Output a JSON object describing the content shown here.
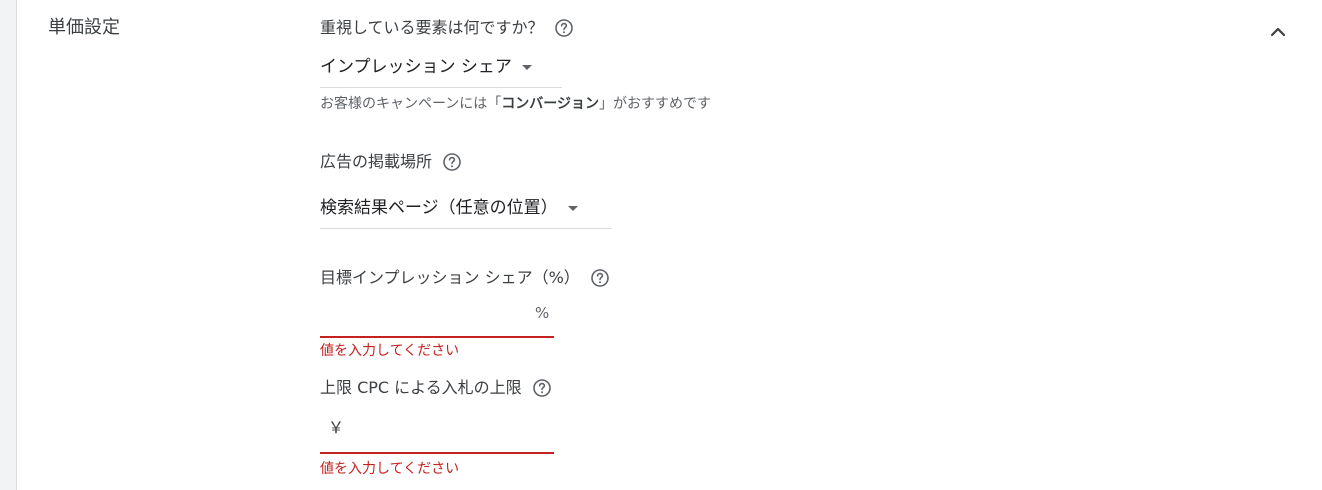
{
  "section": {
    "title": "単価設定",
    "collapse_icon": "chevron-up-icon"
  },
  "focus": {
    "label": "重視している要素は何ですか？",
    "help_icon": "help-circle-icon",
    "selected": "インプレッション シェア",
    "hint_prefix": "お客様のキャンペーンには「",
    "hint_bold": "コンバージョン",
    "hint_suffix": "」がおすすめです"
  },
  "placement": {
    "label": "広告の掲載場所",
    "help_icon": "help-circle-icon",
    "selected": "検索結果ページ（任意の位置）"
  },
  "impression_share": {
    "label": "目標インプレッション シェア（%）",
    "help_icon": "help-circle-icon",
    "value": "",
    "suffix": "%",
    "error": "値を入力してください"
  },
  "max_cpc": {
    "label": "上限 CPC による入札の上限",
    "help_icon": "help-circle-icon",
    "prefix": "￥",
    "value": "",
    "error": "値を入力してください"
  },
  "colors": {
    "error": "#c5221f",
    "text": "#202124",
    "muted": "#5f6368",
    "divider": "#dadce0"
  }
}
